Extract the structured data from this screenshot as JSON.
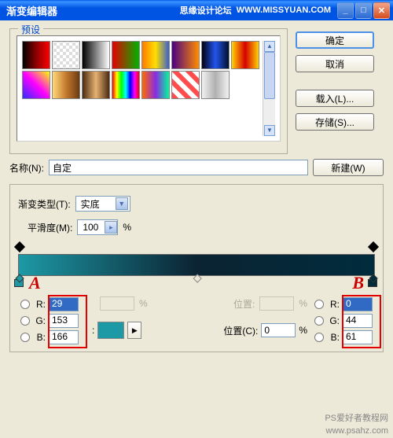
{
  "titlebar": {
    "title": "渐变编辑器",
    "watermark1": "思缘设计论坛",
    "watermark2": "WWW.MISSYUAN.COM"
  },
  "presets": {
    "legend": "预设"
  },
  "sidebar": {
    "ok": "确定",
    "cancel": "取消",
    "load": "载入(L)...",
    "save": "存储(S)..."
  },
  "name": {
    "label": "名称(N):",
    "value": "自定",
    "new_btn": "新建(W)"
  },
  "gradient": {
    "type_label": "渐变类型(T):",
    "type_value": "实底",
    "smooth_label": "平滑度(M):",
    "smooth_value": "100",
    "pct": "%"
  },
  "markers": {
    "a": "A",
    "b": "B"
  },
  "stop_row1": {
    "pos_label": "位置:",
    "pct": "%"
  },
  "stop_row2": {
    "pos_label": "位置(C):",
    "pos_value": "0",
    "pct": "%"
  },
  "left_rgb": {
    "r_label": "R:",
    "r": "29",
    "g_label": "G:",
    "g": "153",
    "b_label": "B:",
    "b": "166"
  },
  "right_rgb": {
    "r_label": "R:",
    "r": "0",
    "g_label": "G:",
    "g": "44",
    "b_label": "B:",
    "b": "61"
  },
  "swatch_gradients": [
    "linear-gradient(to right,#000,#8B0000,#FF0000)",
    "repeating-conic-gradient(#fff 0 25%,#ddd 0 50%) 50%/8px 8px",
    "linear-gradient(to right,#000,#fff)",
    "linear-gradient(to right,#E60000,#00B300)",
    "linear-gradient(to right,#FF7A00,#FFE000,#3A5FCD)",
    "linear-gradient(to right,#4B0082,#FF8C00)",
    "linear-gradient(to right,#001,#2255EE,#00102A)",
    "linear-gradient(to right,#FFD200,#D60000,#FFD200)",
    "linear-gradient(45deg,#2E2EFE,#FF00FF,#FFFF00)",
    "linear-gradient(to right,#FFD97A,#C47A2F,#6B3A12)",
    "linear-gradient(to right,#4B2A10,#E7B273,#4B2A10)",
    "linear-gradient(to right,#FF0000,#FFFF00,#00FF00,#00FFFF,#0000FF,#FF00FF,#FF0000)",
    "linear-gradient(to right,#FF6A00,#8A2BE2,#00FA9A)",
    "repeating-linear-gradient(45deg,#FF4D4D 0 6px,#fff 6px 12px)",
    "linear-gradient(to right,#F2F2F2,#B0B0B0,#F2F2F2)"
  ],
  "footer": {
    "line1": "PS爱好者教程网",
    "line2": "www.psahz.com"
  }
}
